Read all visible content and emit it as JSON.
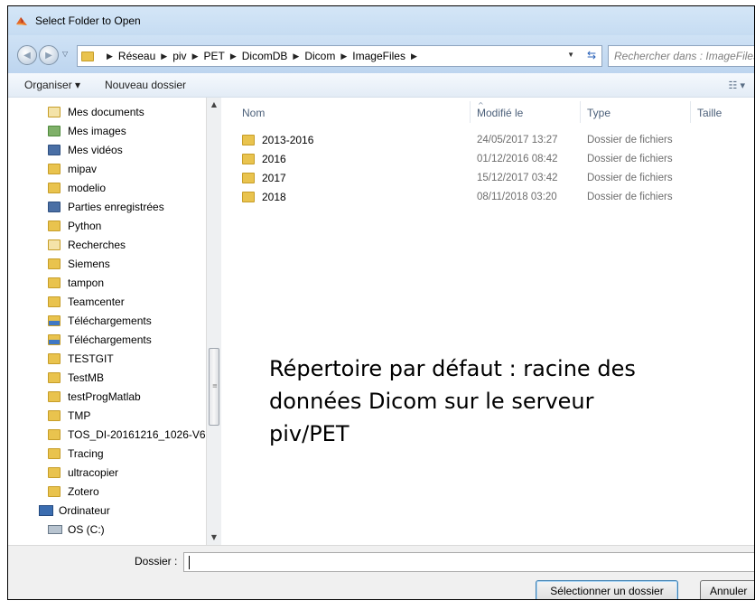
{
  "window": {
    "title": "Select Folder to Open"
  },
  "address": {
    "breadcrumbs": [
      "Réseau",
      "piv",
      "PET",
      "DicomDB",
      "Dicom",
      "ImageFiles"
    ],
    "search_placeholder": "Rechercher dans : ImageFiles"
  },
  "toolbar": {
    "organize_label": "Organiser ▾",
    "new_folder_label": "Nouveau dossier"
  },
  "nav": {
    "items": [
      {
        "label": "Mes documents",
        "icon": "documents-icon"
      },
      {
        "label": "Mes images",
        "icon": "pictures-icon"
      },
      {
        "label": "Mes vidéos",
        "icon": "videos-icon"
      },
      {
        "label": "mipav",
        "icon": "folder-icon"
      },
      {
        "label": "modelio",
        "icon": "folder-icon"
      },
      {
        "label": "Parties enregistrées",
        "icon": "saved-games-icon"
      },
      {
        "label": "Python",
        "icon": "folder-icon"
      },
      {
        "label": "Recherches",
        "icon": "searches-icon"
      },
      {
        "label": "Siemens",
        "icon": "folder-icon"
      },
      {
        "label": "tampon",
        "icon": "folder-icon"
      },
      {
        "label": "Teamcenter",
        "icon": "folder-icon"
      },
      {
        "label": "Téléchargements",
        "icon": "downloads-icon"
      },
      {
        "label": "Téléchargements",
        "icon": "downloads-icon"
      },
      {
        "label": "TESTGIT",
        "icon": "folder-icon"
      },
      {
        "label": "TestMB",
        "icon": "folder-icon"
      },
      {
        "label": "testProgMatlab",
        "icon": "folder-icon"
      },
      {
        "label": "TMP",
        "icon": "folder-icon"
      },
      {
        "label": "TOS_DI-20161216_1026-V6",
        "icon": "folder-icon"
      },
      {
        "label": "Tracing",
        "icon": "folder-icon"
      },
      {
        "label": "ultracopier",
        "icon": "folder-icon"
      },
      {
        "label": "Zotero",
        "icon": "folder-icon"
      }
    ],
    "computer_label": "Ordinateur",
    "drive_label": "OS (C:)"
  },
  "columns": {
    "name": "Nom",
    "modified": "Modifié le",
    "type": "Type",
    "size": "Taille"
  },
  "files": [
    {
      "name": "2013-2016",
      "modified": "24/05/2017 13:27",
      "type": "Dossier de fichiers"
    },
    {
      "name": "2016",
      "modified": "01/12/2016 08:42",
      "type": "Dossier de fichiers"
    },
    {
      "name": "2017",
      "modified": "15/12/2017 03:42",
      "type": "Dossier de fichiers"
    },
    {
      "name": "2018",
      "modified": "08/11/2018 03:20",
      "type": "Dossier de fichiers"
    }
  ],
  "annotation": {
    "line1": "Répertoire par défaut : racine des",
    "line2": "données Dicom sur le serveur",
    "line3": "piv/PET"
  },
  "bottom": {
    "folder_label": "Dossier :",
    "folder_value": "",
    "select_label": "Sélectionner un dossier",
    "cancel_label": "Annuler"
  }
}
